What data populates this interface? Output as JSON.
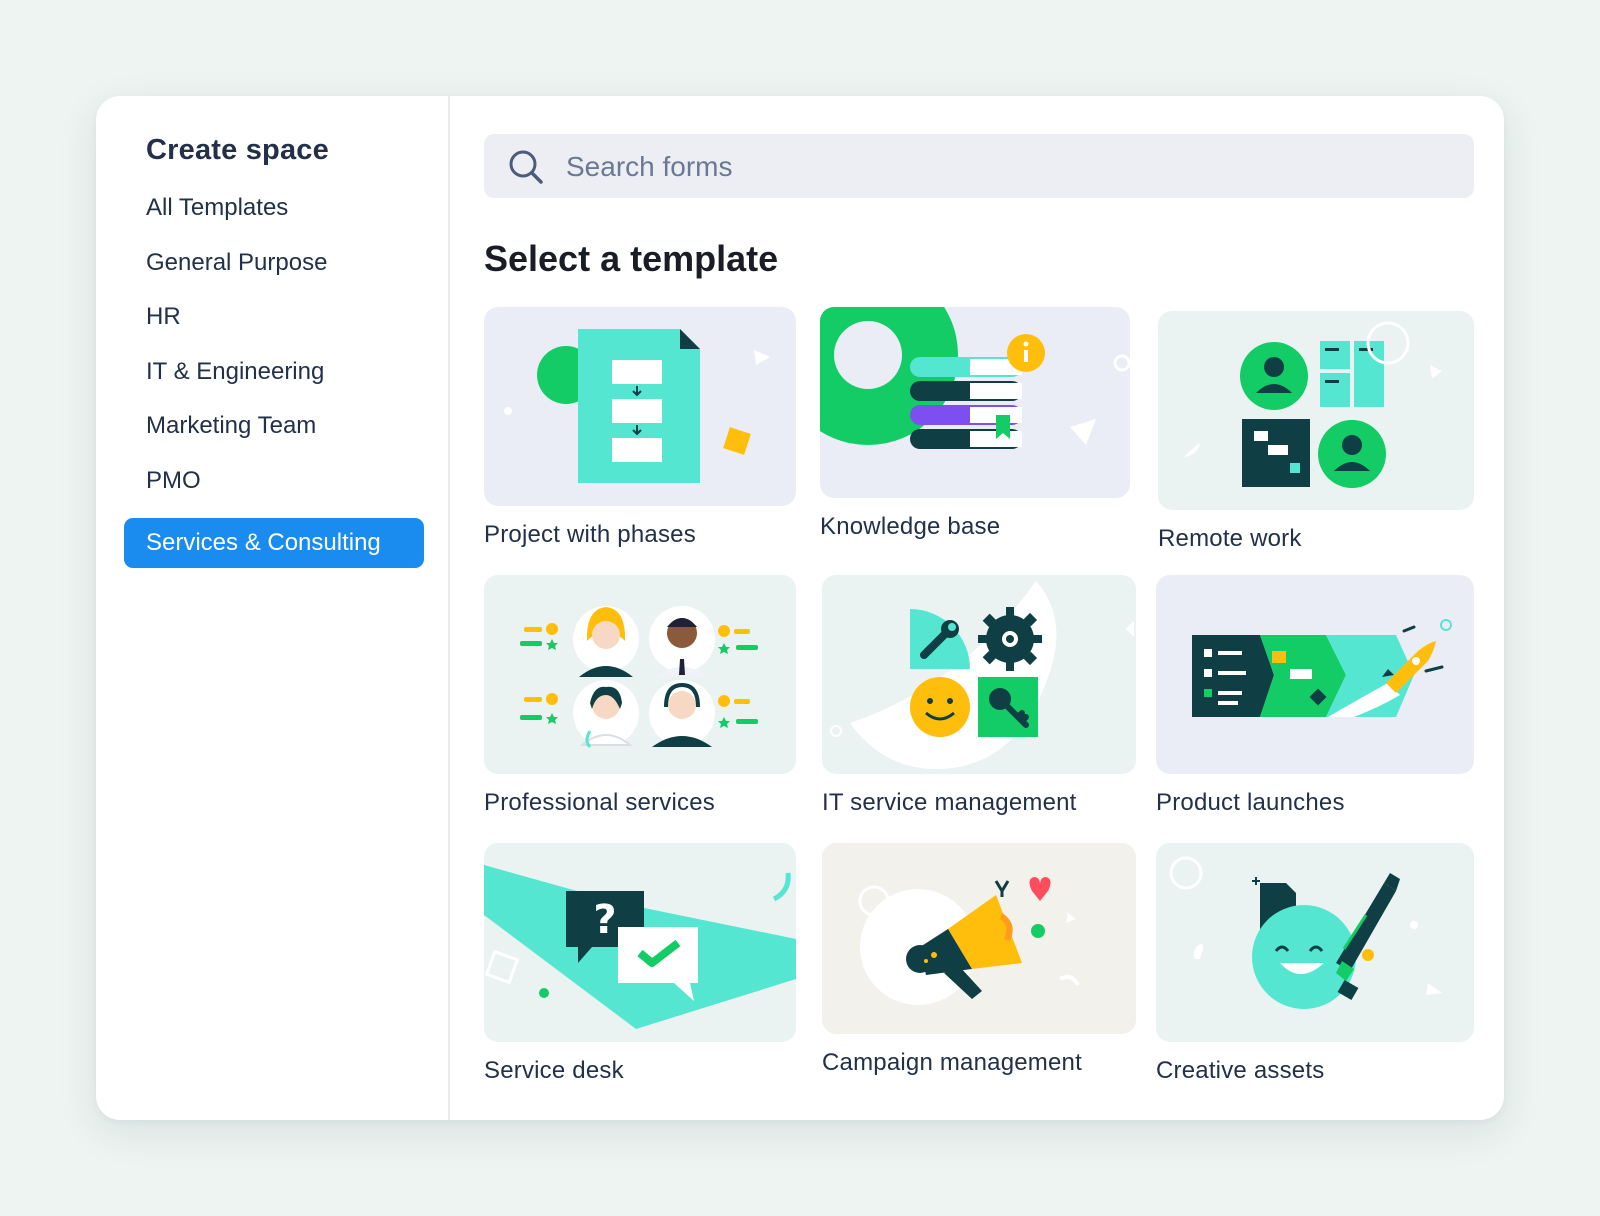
{
  "sidebar": {
    "title": "Create space",
    "items": [
      {
        "label": "All Templates",
        "active": false
      },
      {
        "label": "General Purpose",
        "active": false
      },
      {
        "label": "HR",
        "active": false
      },
      {
        "label": "IT & Engineering",
        "active": false
      },
      {
        "label": "Marketing Team",
        "active": false
      },
      {
        "label": "PMO",
        "active": false
      },
      {
        "label": "Services & Consulting",
        "active": true
      }
    ]
  },
  "search": {
    "placeholder": "Search forms"
  },
  "main": {
    "title": "Select a template",
    "templates": [
      {
        "label": "Project with phases",
        "icon": "document-phases-icon"
      },
      {
        "label": "Knowledge base",
        "icon": "books-stack-icon"
      },
      {
        "label": "Remote work",
        "icon": "remote-team-icon"
      },
      {
        "label": "Professional services",
        "icon": "people-avatars-icon"
      },
      {
        "label": "IT service management",
        "icon": "gear-wrench-key-icon"
      },
      {
        "label": "Product launches",
        "icon": "rocket-launch-icon"
      },
      {
        "label": "Service desk",
        "icon": "chat-question-icon"
      },
      {
        "label": "Campaign management",
        "icon": "megaphone-icon"
      },
      {
        "label": "Creative assets",
        "icon": "smiley-pen-icon"
      }
    ]
  },
  "colors": {
    "accent": "#1a8cf0",
    "brand_green": "#13cc66",
    "brand_teal": "#55e6d2",
    "dark_teal": "#0f3f44",
    "yellow": "#ffbe0b",
    "purple": "#7d4ff0"
  }
}
